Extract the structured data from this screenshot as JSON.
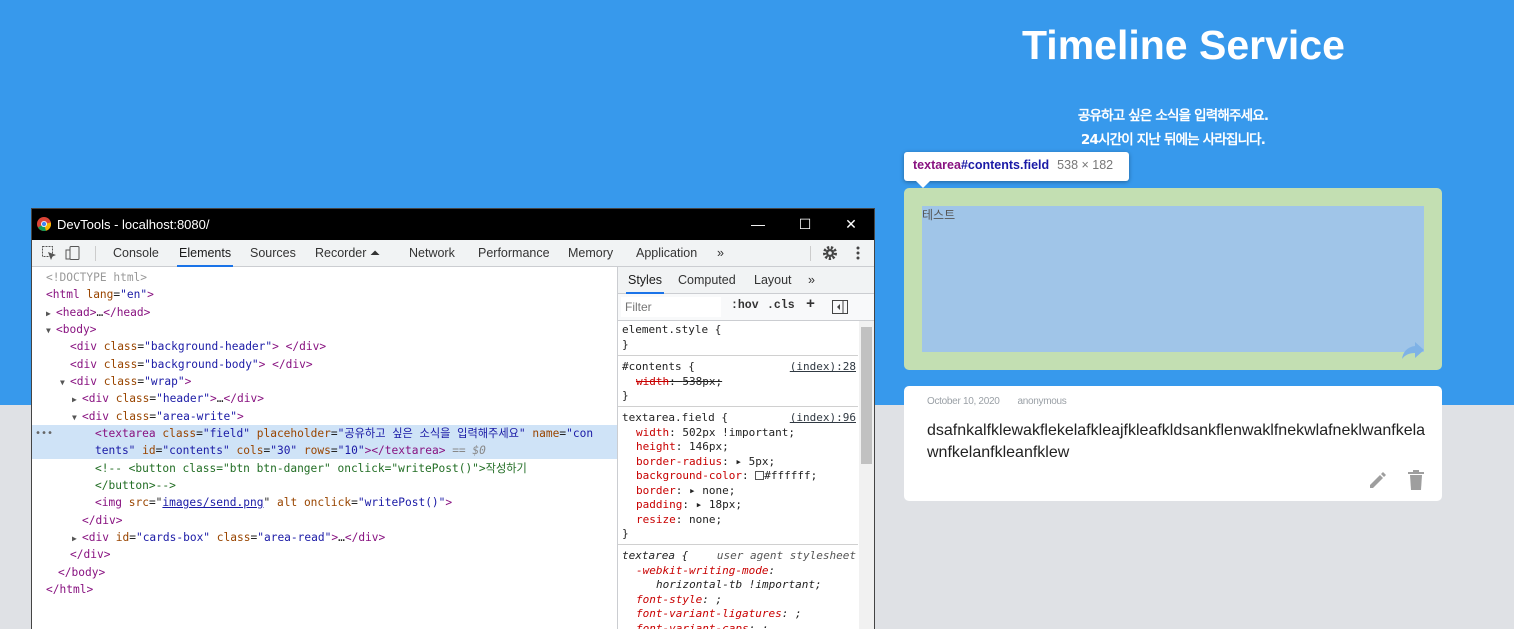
{
  "site": {
    "title": "Timeline Service",
    "subtitle_1": "공유하고 싶은 소식을 입력해주세요.",
    "subtitle_2": "24시간이 지난 뒤에는 사라집니다."
  },
  "inspect_tooltip": {
    "tag": "textarea",
    "selector": "#contents.field",
    "size": "538 × 182"
  },
  "write_area": {
    "value": "테스트",
    "send_icon": "share-arrow-icon"
  },
  "card": {
    "date": "October 10, 2020",
    "author": "anonymous",
    "content": "dsafnkalfklewakflekelafkleajfkleafkldsankflenwaklfnekwlafneklwanfkelawnfkelanfkleanfklew",
    "edit_icon": "pencil-icon",
    "delete_icon": "trash-icon"
  },
  "devtools": {
    "window_title": "DevTools - localhost:8080/",
    "window_buttons": {
      "minimize": "—",
      "maximize": "☐",
      "close": "✕"
    },
    "tabs": [
      "Console",
      "Elements",
      "Sources",
      "Recorder ⏶",
      "Network",
      "Performance",
      "Memory",
      "Application",
      "»"
    ],
    "active_tab": "Elements",
    "dom": {
      "doctype": "<!DOCTYPE html>",
      "html_open": "html",
      "html_lang_attr": "lang",
      "html_lang_val": "\"en\"",
      "head": "head",
      "head_ellipsis": "…",
      "body": "body",
      "div": "div",
      "class_attr": "class",
      "id_attr": "id",
      "bg_header": "\"background-header\"",
      "bg_body": "\"background-body\"",
      "wrap": "\"wrap\"",
      "header": "\"header\"",
      "area_write": "\"area-write\"",
      "textarea": "textarea",
      "ta_class": "\"field\"",
      "placeholder_attr": "placeholder",
      "ta_placeholder": "\"공유하고 싶은 소식을 입력해주세요\"",
      "name_attr": "name",
      "ta_name_1": "\"con",
      "ta_name_2": "tents\"",
      "ta_id": "\"contents\"",
      "cols_attr": "cols",
      "ta_cols": "\"30\"",
      "rows_attr": "rows",
      "ta_rows": "\"10\"",
      "eq_sel": "== $0",
      "comment_1": "<!--            <button class=\"btn btn-danger\" onclick=\"writePost()\">작성하기",
      "comment_2": "</button>-->",
      "img": "img",
      "src_attr": "src",
      "img_src": "images/send.png",
      "alt_attr": "alt",
      "onclick_attr": "onclick",
      "img_onclick": "\"writePost()\"",
      "cards_box_id": "\"cards-box\"",
      "area_read": "\"area-read\""
    },
    "styles_tabs": [
      "Styles",
      "Computed",
      "Layout",
      "»"
    ],
    "filter_placeholder": "Filter",
    "filter_buttons": [
      ":hov",
      ".cls",
      "+"
    ],
    "rules": {
      "element_style": "element.style {",
      "close": "}",
      "contents_selector": "#contents {",
      "contents_src": "(index):28",
      "contents_prop": "width",
      "contents_val": "538px",
      "field_selector": "textarea.field {",
      "field_src": "(index):96",
      "field_props": [
        {
          "prop": "width",
          "value": "502px !important;"
        },
        {
          "prop": "height",
          "value": "146px;"
        },
        {
          "prop": "border-radius",
          "value": "▸ 5px;"
        },
        {
          "prop": "background-color",
          "value": "#ffffff;"
        },
        {
          "prop": "border",
          "value": "▸ none;"
        },
        {
          "prop": "padding",
          "value": "▸ 18px;"
        },
        {
          "prop": "resize",
          "value": "none;"
        }
      ],
      "ua_selector": "textarea {",
      "ua_src": "user agent stylesheet",
      "ua_props": [
        {
          "prop": "-webkit-writing-mode",
          "value": ""
        },
        {
          "prop": "",
          "value": "horizontal-tb !important;"
        },
        {
          "prop": "font-style",
          "value": ";"
        },
        {
          "prop": "font-variant-ligatures",
          "value": ";"
        },
        {
          "prop": "font-variant-caps",
          "value": ";"
        }
      ]
    }
  }
}
